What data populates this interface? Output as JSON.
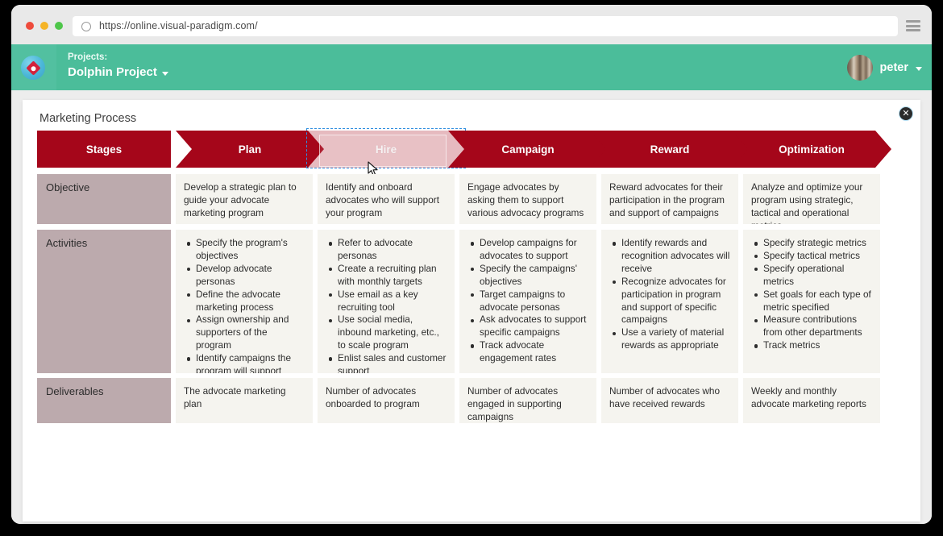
{
  "browser": {
    "url": "https://online.visual-paradigm.com/",
    "reload_icon": "reload-icon",
    "menu_icon": "hamburger-menu-icon"
  },
  "app_header": {
    "logo_icon": "visual-paradigm-logo-icon",
    "projects_label": "Projects:",
    "project_name": "Dolphin Project",
    "project_caret_icon": "chevron-down-icon",
    "user_name": "peter",
    "user_caret_icon": "chevron-down-icon",
    "avatar_icon": "user-avatar",
    "teal": "#4bbd9a"
  },
  "panel": {
    "title": "Marketing Process",
    "close_label": "✕",
    "close_icon": "close-icon"
  },
  "colors": {
    "chevron_red": "#a5061a",
    "row_label_mauve": "#bcaaad",
    "cell_bg": "#f5f4ef",
    "selection_blue": "#2f8fe0"
  },
  "matrix": {
    "corner_header": "Stages",
    "stages": [
      {
        "label": "Plan",
        "state": "normal"
      },
      {
        "label": "Hire",
        "state": "dragging"
      },
      {
        "label": "Campaign",
        "state": "normal"
      },
      {
        "label": "Reward",
        "state": "normal"
      },
      {
        "label": "Optimization",
        "state": "normal"
      }
    ],
    "rows": [
      {
        "label": "Objective",
        "type": "text",
        "cells": [
          "Develop a strategic plan to guide your advocate marketing program",
          "Identify and onboard advocates who will support your program",
          "Engage advocates by asking them to support various advocacy programs",
          "Reward advocates for their participation in the program and support of campaigns",
          "Analyze and optimize your program using strategic, tactical and operational metrics"
        ]
      },
      {
        "label": "Activities",
        "type": "list",
        "cells": [
          [
            "Specify the program's objectives",
            "Develop advocate personas",
            "Define the advocate marketing process",
            "Assign ownership and supporters of the program",
            "Identify campaigns the program will support"
          ],
          [
            "Refer to advocate personas",
            "Create a recruiting plan with monthly targets",
            "Use email as a key recruiting tool",
            "Use social media, inbound marketing, etc., to scale program",
            "Enlist sales and customer support"
          ],
          [
            "Develop campaigns for advocates to support",
            "Specify the campaigns' objectives",
            "Target campaigns to advocate personas",
            "Ask advocates to support specific campaigns",
            "Track advocate engagement rates"
          ],
          [
            "Identify rewards and recognition advocates will receive",
            "Recognize advocates for participation in program and support of specific campaigns",
            "Use a variety of material rewards as appropriate"
          ],
          [
            "Specify strategic metrics",
            "Specify tactical metrics",
            "Specify operational metrics",
            "Set goals for each type of metric specified",
            "Measure contributions from other departments",
            "Track metrics"
          ]
        ]
      },
      {
        "label": "Deliverables",
        "type": "text",
        "cells": [
          "The advocate marketing plan",
          "Number of advocates onboarded to program",
          "Number of advocates engaged in supporting campaigns",
          "Number of advocates who have received rewards",
          "Weekly and monthly advocate marketing reports"
        ]
      }
    ]
  }
}
